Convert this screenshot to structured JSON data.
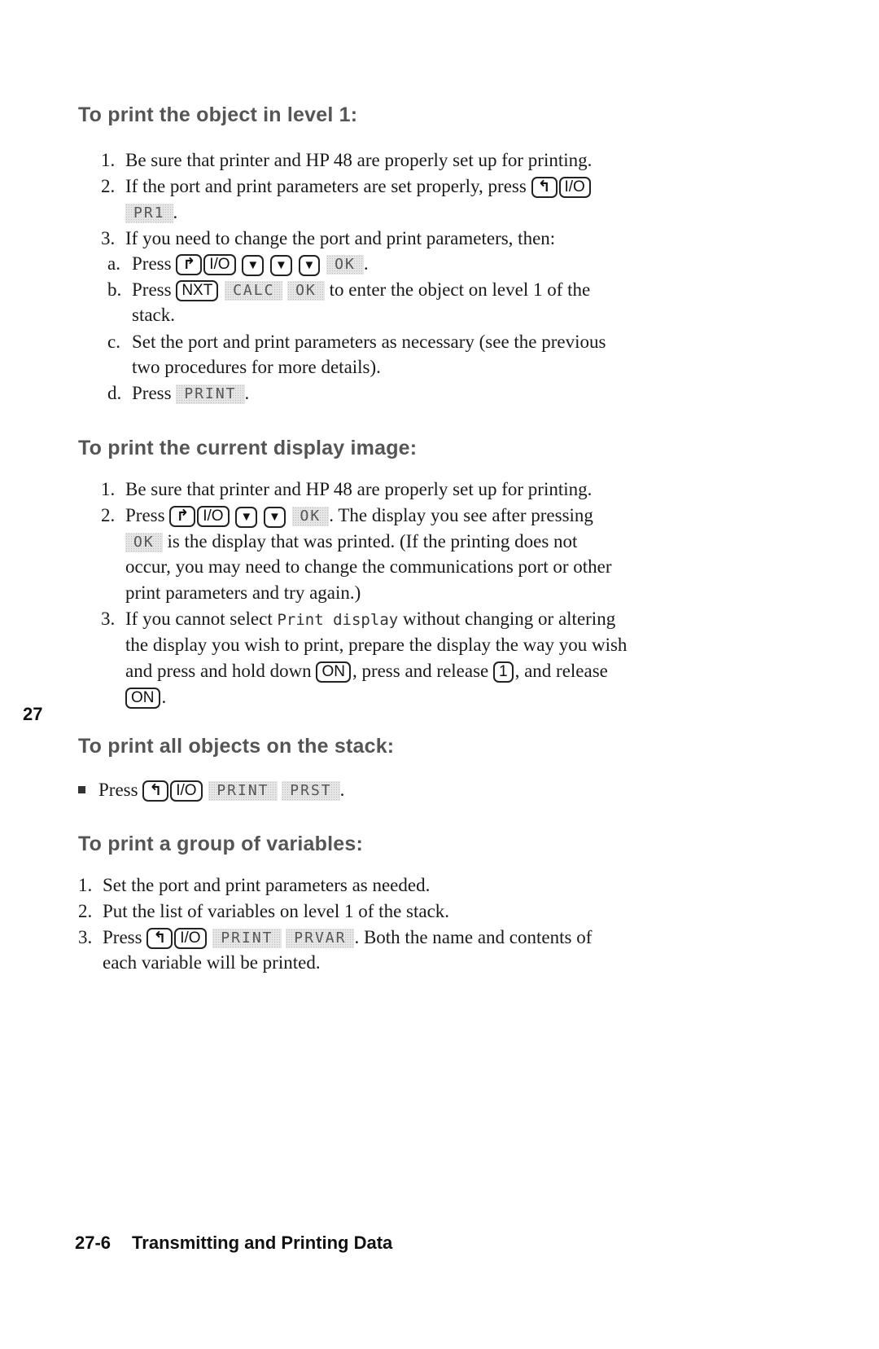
{
  "sections": [
    {
      "heading": "To print the object in level 1:",
      "steps": [
        {
          "num": "1.",
          "text": "Be sure that printer and HP 48 are properly set up for printing."
        },
        {
          "num": "2.",
          "text_before": "If the port and print parameters are set properly, press",
          "keys": [
            "left-shift",
            "I/O"
          ],
          "softkey": "PR1",
          "text_after": "."
        },
        {
          "num": "3.",
          "text": "If you need to change the port and print parameters, then:"
        },
        {
          "num": "a.",
          "text_before": "Press",
          "keys": [
            "right-shift",
            "I/O",
            "down-arrow",
            "down-arrow",
            "down-arrow"
          ],
          "softkey": "OK",
          "text_after": "."
        },
        {
          "num": "b.",
          "text_before": "Press",
          "keys": [
            "NXT"
          ],
          "softkeys": [
            "CALC",
            "OK"
          ],
          "text_after": "to enter the object on level 1 of the",
          "continuation": "stack."
        },
        {
          "num": "c.",
          "text": "Set the port and print parameters as necessary (see the previous",
          "continuation": "two procedures for more details)."
        },
        {
          "num": "d.",
          "text_before": "Press",
          "softkey": "PRINT",
          "text_after": "."
        }
      ]
    },
    {
      "heading": "To print the current display image:",
      "steps": [
        {
          "num": "1.",
          "text": "Be sure that printer and HP 48 are properly set up for printing."
        },
        {
          "num": "2.",
          "text_before": "Press",
          "keys": [
            "right-shift",
            "I/O",
            "down-arrow",
            "down-arrow"
          ],
          "softkey": "OK",
          "text_after": ". The display you see after pressing",
          "line2_softkey": "OK",
          "line2_text": "is the display that was printed. (If the printing does not",
          "line3": "occur, you may need to change the communications port or other",
          "line4": "print parameters and try again.)"
        },
        {
          "num": "3.",
          "text_before": "If you cannot select",
          "mono": "Print display",
          "text_after": "without changing or altering",
          "line2": "the display you wish to print, prepare the display the way you wish",
          "line3_a": "and press and hold down",
          "key_on": "ON",
          "line3_b": ", press and release",
          "key_1": "1",
          "line3_c": ", and release",
          "line4_key": "ON",
          "line4_after": "."
        }
      ]
    },
    {
      "heading": "To print all objects on the stack:",
      "steps": [
        {
          "bullet": true,
          "text_before": "Press",
          "keys": [
            "left-shift",
            "I/O"
          ],
          "softkeys": [
            "PRINT",
            "PRST"
          ],
          "text_after": "."
        }
      ]
    },
    {
      "heading": "To print a group of variables:",
      "steps": [
        {
          "num": "1.",
          "text": "Set the port and print parameters as needed."
        },
        {
          "num": "2.",
          "text": "Put the list of variables on level 1 of the stack."
        },
        {
          "num": "3.",
          "text_before": "Press",
          "keys": [
            "left-shift",
            "I/O"
          ],
          "softkeys": [
            "PRINT",
            "PRVAR"
          ],
          "text_after": ". Both the name and contents of",
          "continuation": "each variable will be printed."
        }
      ]
    }
  ],
  "keys": {
    "left_shift": "↰",
    "right_shift": "↱",
    "io": "I/O",
    "down": "▼",
    "nxt": "NXT",
    "on": "ON",
    "one": "1"
  },
  "tab_marker": "27",
  "footer": {
    "page_number": "27-6",
    "chapter_title": "Transmitting and Printing Data"
  }
}
